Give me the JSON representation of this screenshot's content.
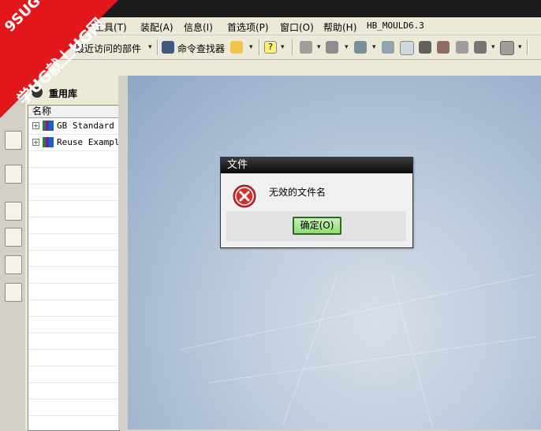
{
  "watermark": {
    "line1": "9SUG",
    "line2": "学UG就上UG网"
  },
  "menu": {
    "items": [
      {
        "label": "工具(T)"
      },
      {
        "label": "装配(A)"
      },
      {
        "label": "信息(I)"
      },
      {
        "label": "首选项(P)"
      },
      {
        "label": "窗口(O)"
      },
      {
        "label": "帮助(H)"
      },
      {
        "label": "HB_MOULD6.3"
      }
    ]
  },
  "toolbar": {
    "recent_parts_label": "最近访问的部件",
    "command_finder_label": "命令查找器"
  },
  "reuse_library": {
    "title": "重用库",
    "column_header": "名称",
    "items": [
      {
        "label": "GB Standard P"
      },
      {
        "label": "Reuse Example"
      }
    ]
  },
  "dialog": {
    "title": "文件",
    "message": "无效的文件名",
    "ok_label": "确定(O)"
  },
  "colors": {
    "watermark_red": "#e3161c",
    "ok_green": "#8fdc74",
    "error_red": "#d32f2f"
  }
}
